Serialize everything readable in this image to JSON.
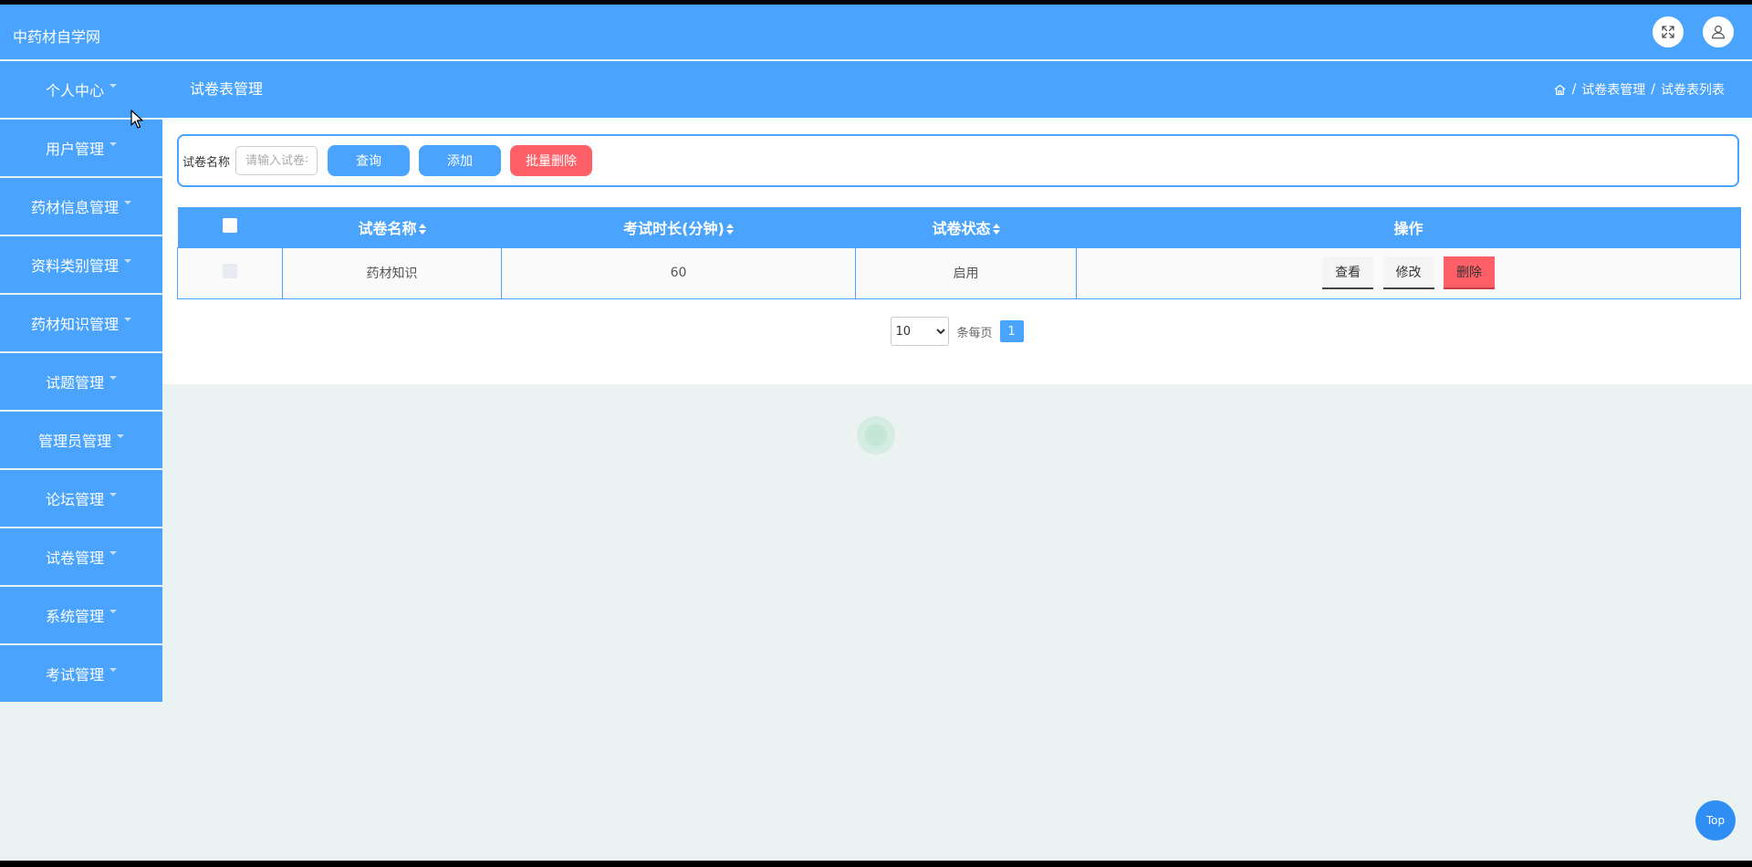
{
  "app": {
    "title": "中药材自学网"
  },
  "colors": {
    "primary": "#4aa3fc",
    "danger": "#ff5f67",
    "background": "#eaf3f1"
  },
  "topbar": {
    "icons": [
      "fullscreen-icon",
      "user-icon"
    ]
  },
  "sidebar": {
    "items": [
      {
        "label": "个人中心"
      },
      {
        "label": "用户管理"
      },
      {
        "label": "药材信息管理"
      },
      {
        "label": "资料类别管理"
      },
      {
        "label": "药材知识管理"
      },
      {
        "label": "试题管理"
      },
      {
        "label": "管理员管理"
      },
      {
        "label": "论坛管理"
      },
      {
        "label": "试卷管理"
      },
      {
        "label": "系统管理"
      },
      {
        "label": "考试管理"
      }
    ]
  },
  "header": {
    "title": "试卷表管理",
    "breadcrumb": {
      "sep": "/",
      "items": [
        "试卷表管理",
        "试卷表列表"
      ]
    }
  },
  "search": {
    "label": "试卷名称",
    "placeholder": "请输入试卷名称",
    "value": "",
    "query_button": "查询",
    "add_button": "添加",
    "batch_delete_button": "批量删除"
  },
  "table": {
    "columns": [
      "试卷名称",
      "考试时长(分钟)",
      "试卷状态",
      "操作"
    ],
    "rows": [
      {
        "name": "药材知识",
        "duration": "60",
        "status": "启用"
      }
    ],
    "actions": {
      "view": "查看",
      "edit": "修改",
      "delete": "删除"
    }
  },
  "pagination": {
    "page_size": "10",
    "page_size_options": [
      "10"
    ],
    "per_page_text": "条每页",
    "current_page": "1"
  },
  "back_to_top": "Top"
}
